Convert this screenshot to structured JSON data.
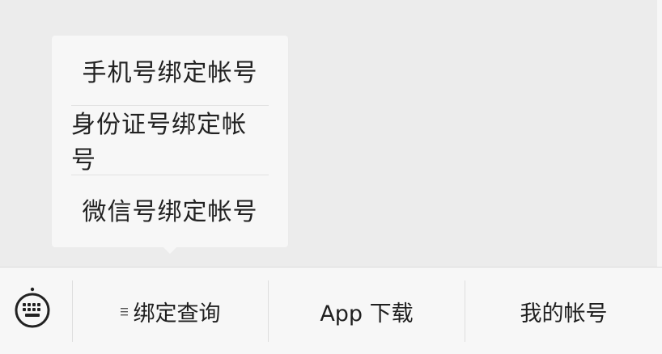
{
  "popup_menu": {
    "items": [
      {
        "label": "手机号绑定帐号"
      },
      {
        "label": "身份证号绑定帐号"
      },
      {
        "label": "微信号绑定帐号"
      }
    ]
  },
  "bottom_menu": {
    "keyboard_icon": "keyboard-icon",
    "buttons": [
      {
        "label": "绑定查询",
        "icon": "list-icon"
      },
      {
        "label": "App 下载"
      },
      {
        "label": "我的帐号"
      }
    ]
  },
  "colors": {
    "background": "#ececec",
    "panel": "#f7f7f7",
    "text": "#1f1f1f",
    "divider": "#dedede"
  }
}
